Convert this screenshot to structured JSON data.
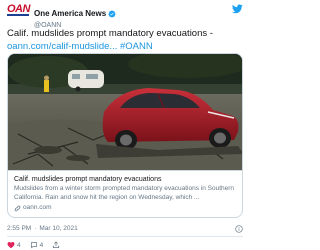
{
  "account": {
    "display_name": "One America News",
    "handle": "@OANN",
    "avatar_text": "OAN"
  },
  "tweet": {
    "text": "Calif. mudslides prompt mandatory evacuations -",
    "link_text": "oann.com/calif-mudslide...",
    "hashtag": "#OANN"
  },
  "card": {
    "title": "Calif. mudslides prompt mandatory evacuations",
    "description": "Mudslides from a winter storm prompted mandatory evacuations in Southern California. Rain and snow hit the region on Wednesday, which ...",
    "domain": "oann.com"
  },
  "meta": {
    "time": "2:55 PM",
    "separator": "·",
    "date": "Mar 10, 2021"
  },
  "actions": {
    "likes": "4",
    "retweets": "4"
  },
  "colors": {
    "link": "#1b95e0",
    "verified": "#1da1f2",
    "like": "#e0245e",
    "car": "#b0202a"
  },
  "icons": [
    "verified-icon",
    "twitter-icon",
    "link-icon",
    "info-icon",
    "heart-icon",
    "comment-icon",
    "share-icon"
  ]
}
